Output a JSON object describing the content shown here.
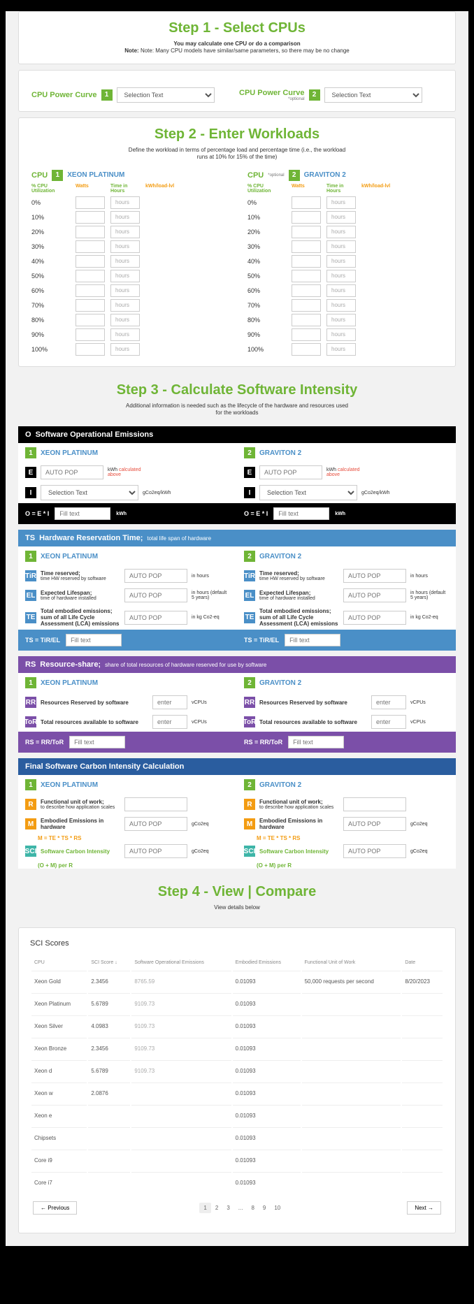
{
  "step1": {
    "title": "Step 1 - Select CPUs",
    "sub1": "You may calculate one CPU or do a comparison",
    "sub2": "Note: Many CPU models have similar/same parameters, so there may be no change",
    "label": "CPU Power Curve",
    "opt": "*optional",
    "sel": "Selection Text"
  },
  "step2": {
    "title": "Step 2 - Enter Workloads",
    "sub": "Define the workload in terms of percentage load and percentage time (i.e., the workload runs at 10% for 15% of the time)",
    "cpulabel": "CPU",
    "cpu1": "XEON PLATINUM",
    "cpu2": "GRAVITON 2",
    "h1": "% CPU Utilization",
    "h2": "Watts",
    "h3": "Time in Hours",
    "h4": "kWh/load-lvl",
    "hours": "hours",
    "pcts": [
      "0%",
      "10%",
      "20%",
      "30%",
      "40%",
      "50%",
      "60%",
      "70%",
      "80%",
      "90%",
      "100%"
    ]
  },
  "step3": {
    "title": "Step 3 - Calculate Software Intensity",
    "sub": "Additional information is needed such as the lifecycle of the hardware and resources used for the workloads"
  },
  "secO": {
    "badge": "O",
    "title": "Software Operational Emissions",
    "E": "E",
    "I": "I",
    "auto": "AUTO POP",
    "sel": "Selection Text",
    "kwh": "kWh",
    "note": "calculated above",
    "u2": "gCo2eq/kWh",
    "formula": "O = E * I",
    "fill": "Fill text"
  },
  "secTS": {
    "badge": "TS",
    "title": "Hardware Reservation Time;",
    "sm": "total life span of hardware",
    "TiR": "TiR",
    "TiRlbl": "Time reserved;",
    "TiRsub": "time HW reserved by software",
    "EL": "EL",
    "ELlbl": "Expected Lifespan;",
    "ELsub": "time of hardware installed",
    "TE": "TE",
    "TElbl": "Total embodied emissions; sum of all Life Cycle Assessment (LCA) emissions",
    "uhours": "in hours",
    "udefault": "in hours (default 5 years)",
    "ukg": "in kg Co2-eq",
    "formula": "TS = TiR/EL"
  },
  "secRS": {
    "badge": "RS",
    "title": "Resource-share;",
    "sm": "share of total resources of hardware reserved for use by software",
    "RR": "RR",
    "RRlbl": "Resources Reserved by software",
    "ToR": "ToR",
    "ToRlbl": "Total resources available to software",
    "enter": "enter",
    "vcpu": "vCPUs",
    "formula": "RS = RR/ToR"
  },
  "secF": {
    "title": "Final Software Carbon Intensity Calculation",
    "R": "R",
    "Rlbl": "Functional unit of work;",
    "Rsub": "to describe how application scales",
    "M": "M",
    "Mlbl": "Embodied Emissions in hardware",
    "Mform": "M = TE * TS * RS",
    "SCI": "SCI",
    "SCIlbl": "Software Carbon Intensity",
    "SCIform": "(O + M) per R",
    "gco": "gCo2eq"
  },
  "step4": {
    "title": "Step 4 - View | Compare",
    "sub": "View details below",
    "tbltitle": "SCI Scores",
    "cols": [
      "CPU",
      "SCI Score ↓",
      "Software Operational Emissions",
      "Embodied Emissions",
      "Functional Unit of Work",
      "Date"
    ],
    "rows": [
      {
        "c": "Xeon Gold",
        "s": "2.3456",
        "o": "8765.59",
        "e": "0.01093",
        "f": "50,000 requests per second",
        "d": "8/20/2023"
      },
      {
        "c": "Xeon Platinum",
        "s": "5.6789",
        "o": "9109.73",
        "e": "0.01093",
        "f": "",
        "d": ""
      },
      {
        "c": "Xeon Silver",
        "s": "4.0983",
        "o": "9109.73",
        "e": "0.01093",
        "f": "",
        "d": ""
      },
      {
        "c": "Xeon Bronze",
        "s": "2.3456",
        "o": "9109.73",
        "e": "0.01093",
        "f": "",
        "d": ""
      },
      {
        "c": "Xeon d",
        "s": "5.6789",
        "o": "9109.73",
        "e": "0.01093",
        "f": "",
        "d": ""
      },
      {
        "c": "Xeon w",
        "s": "2.0876",
        "o": "",
        "e": "0.01093",
        "f": "",
        "d": ""
      },
      {
        "c": "Xeon e",
        "s": "",
        "o": "",
        "e": "0.01093",
        "f": "",
        "d": ""
      },
      {
        "c": "Chipsets",
        "s": "",
        "o": "",
        "e": "0.01093",
        "f": "",
        "d": ""
      },
      {
        "c": "Core i9",
        "s": "",
        "o": "",
        "e": "0.01093",
        "f": "",
        "d": ""
      },
      {
        "c": "Core i7",
        "s": "",
        "o": "",
        "e": "0.01093",
        "f": "",
        "d": ""
      }
    ],
    "prev": "← Previous",
    "next": "Next →",
    "pages": [
      "1",
      "2",
      "3",
      "...",
      "8",
      "9",
      "10"
    ]
  }
}
